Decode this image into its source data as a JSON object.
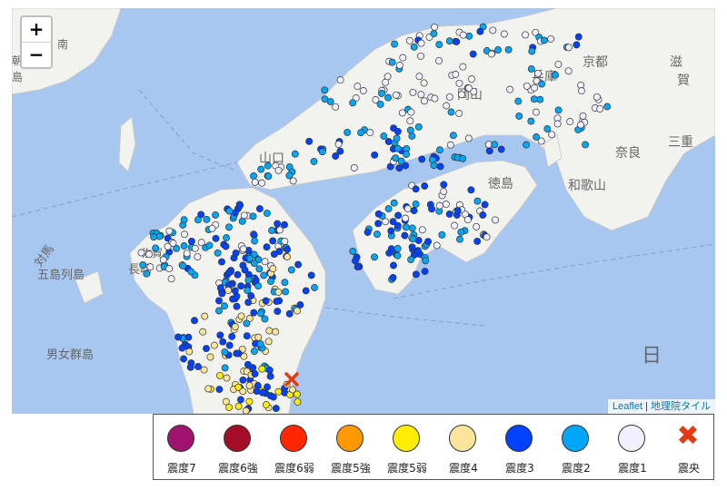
{
  "map": {
    "zoom_in": "+",
    "zoom_out": "−",
    "attribution": {
      "leaflet": "Leaflet",
      "sep": " | ",
      "tiles": "地理院タイル"
    },
    "places": [
      "南",
      "朝",
      "島",
      "兵庫",
      "京都",
      "滋",
      "賀",
      "岡山",
      "山口",
      "奈良",
      "三重",
      "和歌山",
      "徳島",
      "対馬",
      "長崎",
      "佐賀",
      "五島列島",
      "男女群島",
      "日"
    ],
    "epicenter_icon": "cross-icon",
    "colors": {
      "water": "#a8c7f0",
      "land": "#f2f2ee",
      "int7": "#a0136e",
      "int6plus": "#a50d27",
      "int6minus": "#ff2600",
      "int5plus": "#ff9900",
      "int5minus": "#ffee00",
      "int4": "#fce49a",
      "int3": "#0042ff",
      "int2": "#00a6f8",
      "int1": "#f0f0ff",
      "epicenter": "#e33a12"
    }
  },
  "legend": [
    {
      "label": "震度7",
      "color": "#a0136e"
    },
    {
      "label": "震度6強",
      "color": "#a50d27"
    },
    {
      "label": "震度6弱",
      "color": "#ff2600"
    },
    {
      "label": "震度5強",
      "color": "#ff9900"
    },
    {
      "label": "震度5弱",
      "color": "#ffee00"
    },
    {
      "label": "震度4",
      "color": "#fce49a"
    },
    {
      "label": "震度3",
      "color": "#0042ff"
    },
    {
      "label": "震度2",
      "color": "#00a6f8"
    },
    {
      "label": "震度1",
      "color": "#f0f0ff"
    },
    {
      "label": "震央",
      "color": "#e33a12"
    }
  ]
}
